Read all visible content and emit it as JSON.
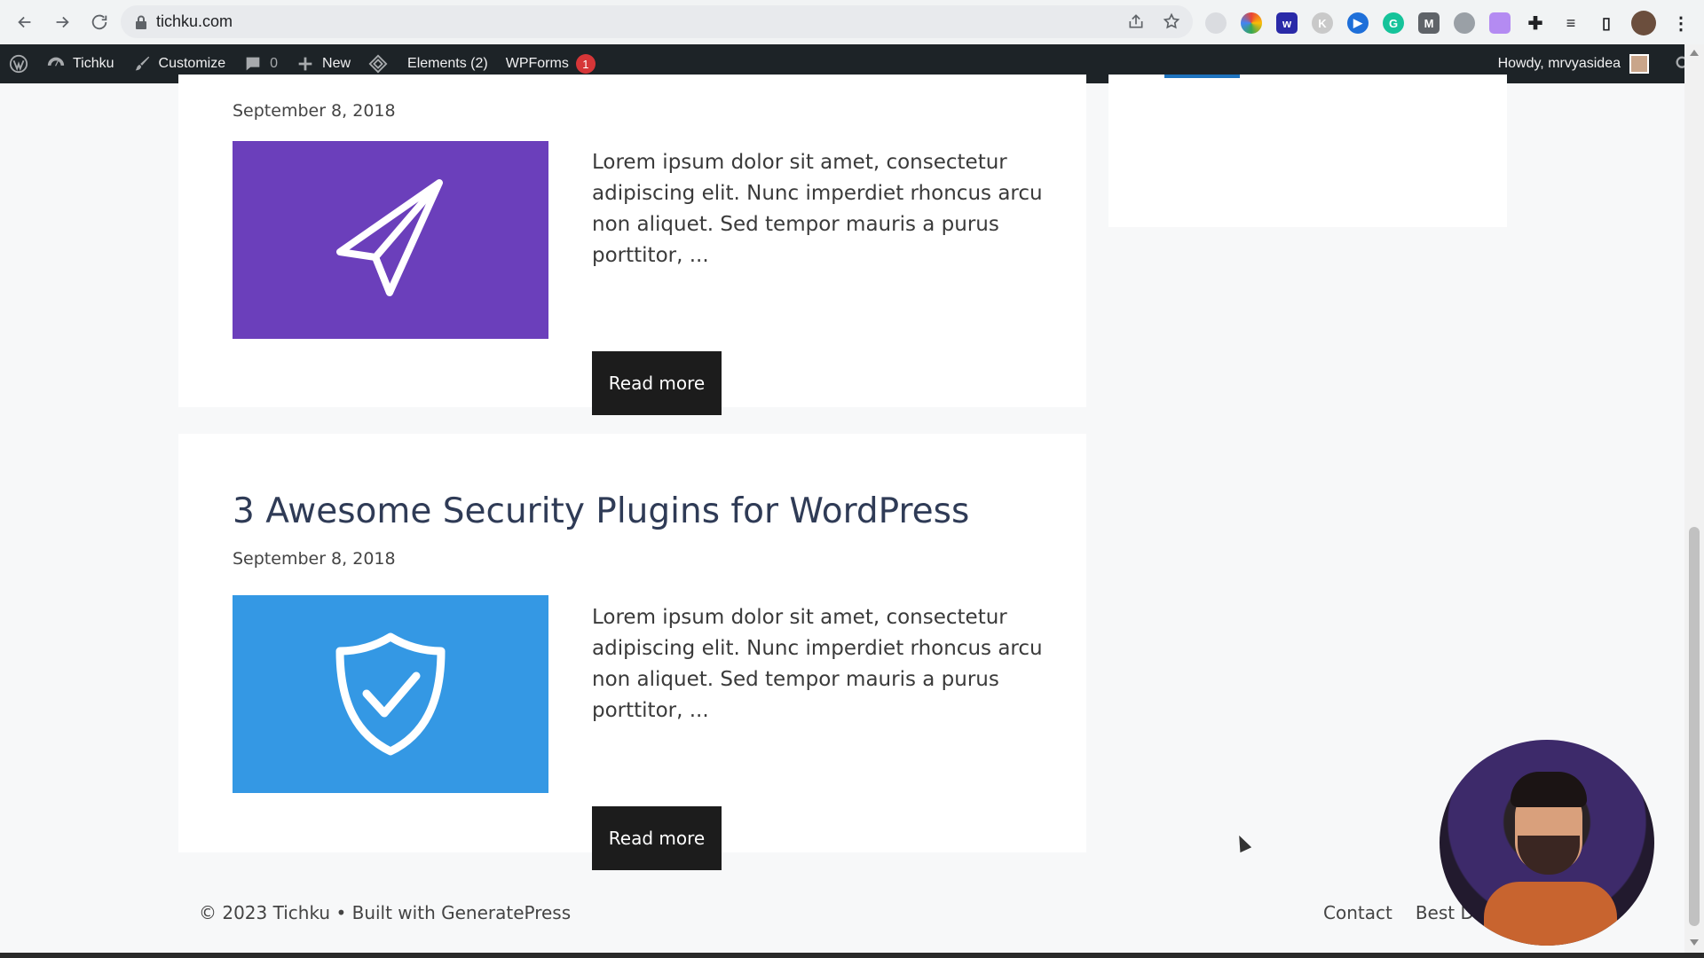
{
  "browser": {
    "url": "tichku.com",
    "extensions": [
      "extension-icon-1",
      "extension-icon-2",
      "extension-icon-3",
      "extension-icon-4",
      "extension-icon-5",
      "extension-icon-6",
      "extension-icon-7",
      "extension-icon-8",
      "extension-icon-9"
    ]
  },
  "adminbar": {
    "site_name": "Tichku",
    "customize": "Customize",
    "comments_count": "0",
    "new": "New",
    "elements": "Elements (2)",
    "wpforms": "WPForms",
    "wpforms_badge": "1",
    "howdy": "Howdy, mrvyasidea"
  },
  "posts": [
    {
      "title": "",
      "date": "September 8, 2018",
      "excerpt": "Lorem ipsum dolor sit amet, consectetur adipiscing elit. Nunc imperdiet rhoncus arcu non aliquet. Sed tempor mauris a purus porttitor, ...",
      "read_more": "Read more",
      "thumb_icon": "paper-plane-icon",
      "thumb_color": "#6b3fbb"
    },
    {
      "title": "3 Awesome Security Plugins for WordPress",
      "date": "September 8, 2018",
      "excerpt": "Lorem ipsum dolor sit amet, consectetur adipiscing elit. Nunc imperdiet rhoncus arcu non aliquet. Sed tempor mauris a purus porttitor, ...",
      "read_more": "Read more",
      "thumb_icon": "shield-check-icon",
      "thumb_color": "#3498e4"
    }
  ],
  "footer": {
    "copyright": "© 2023 Tichku • Built with GeneratePress",
    "links": [
      "Contact",
      "Best Dea"
    ]
  },
  "colors": {
    "adminbar_bg": "#1d2327",
    "button_bg": "#1c1c1c",
    "title_color": "#2f3b56"
  }
}
